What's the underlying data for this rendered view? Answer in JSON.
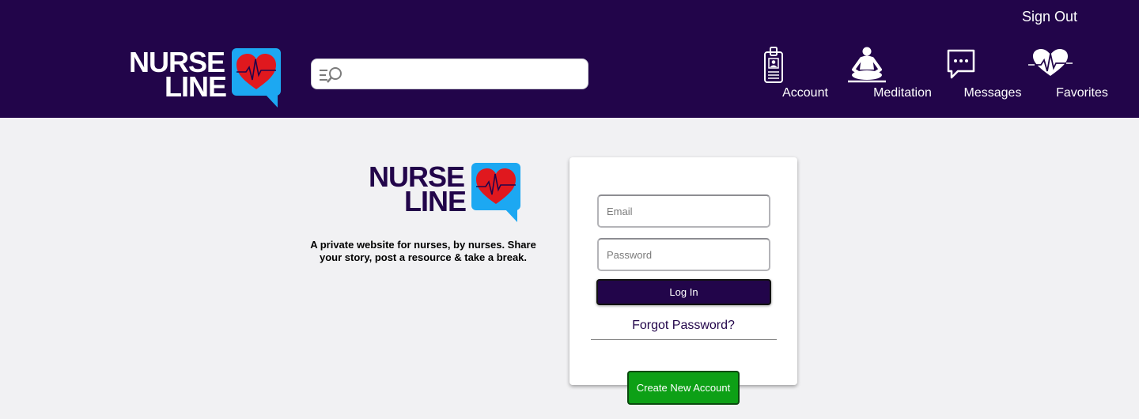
{
  "header": {
    "sign_out_label": "Sign Out",
    "logo": {
      "line1": "NURSE",
      "line2": "LINE"
    },
    "search": {
      "placeholder": "",
      "value": ""
    },
    "nav": [
      {
        "label": "Account",
        "icon": "id-badge-icon"
      },
      {
        "label": "Meditation",
        "icon": "meditation-icon"
      },
      {
        "label": "Messages",
        "icon": "chat-bubble-icon"
      },
      {
        "label": "Favorites",
        "icon": "heartbeat-icon"
      }
    ]
  },
  "main": {
    "logo": {
      "line1": "NURSE",
      "line2": "LINE"
    },
    "tagline": "A private website for nurses, by nurses. Share your story, post a resource & take a break."
  },
  "login": {
    "email_placeholder": "Email",
    "password_placeholder": "Password",
    "login_label": "Log In",
    "forgot_label": "Forgot Password?",
    "create_label": "Create New Account"
  },
  "colors": {
    "header_bg": "#22054a",
    "page_bg": "#f1f1f3",
    "brand_blue": "#1ca8f2",
    "heart_red": "#e0181e",
    "create_green": "#0da016"
  }
}
